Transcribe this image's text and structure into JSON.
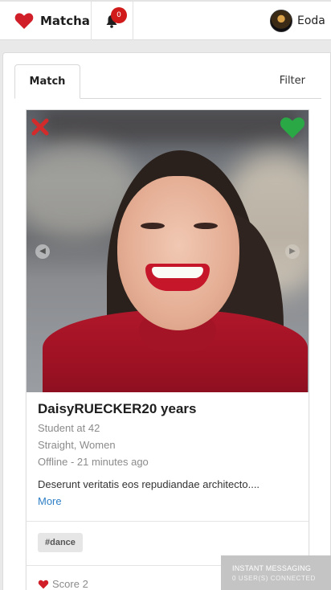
{
  "navbar": {
    "brand": "Matcha",
    "notifications_count": "0",
    "username": "Eoda"
  },
  "tabs": {
    "match": "Match",
    "filter": "Filter"
  },
  "profile": {
    "name": "DaisyRUECKER20 years",
    "occupation": "Student at 42",
    "orientation": "Straight, Women",
    "status": "Offline - 21 minutes ago",
    "bio": "Deserunt veritatis eos repudiandae architecto....",
    "more_link": "More",
    "tags": [
      "#dance"
    ],
    "score": "Score 2"
  },
  "instant_messaging": {
    "title": "INSTANT MESSAGING",
    "subtitle": "0 USER(S) CONNECTED"
  },
  "colors": {
    "brand_heart": "#d11f2a",
    "dislike": "#d32b2b",
    "like": "#2aa845",
    "link": "#2f7fc6"
  }
}
